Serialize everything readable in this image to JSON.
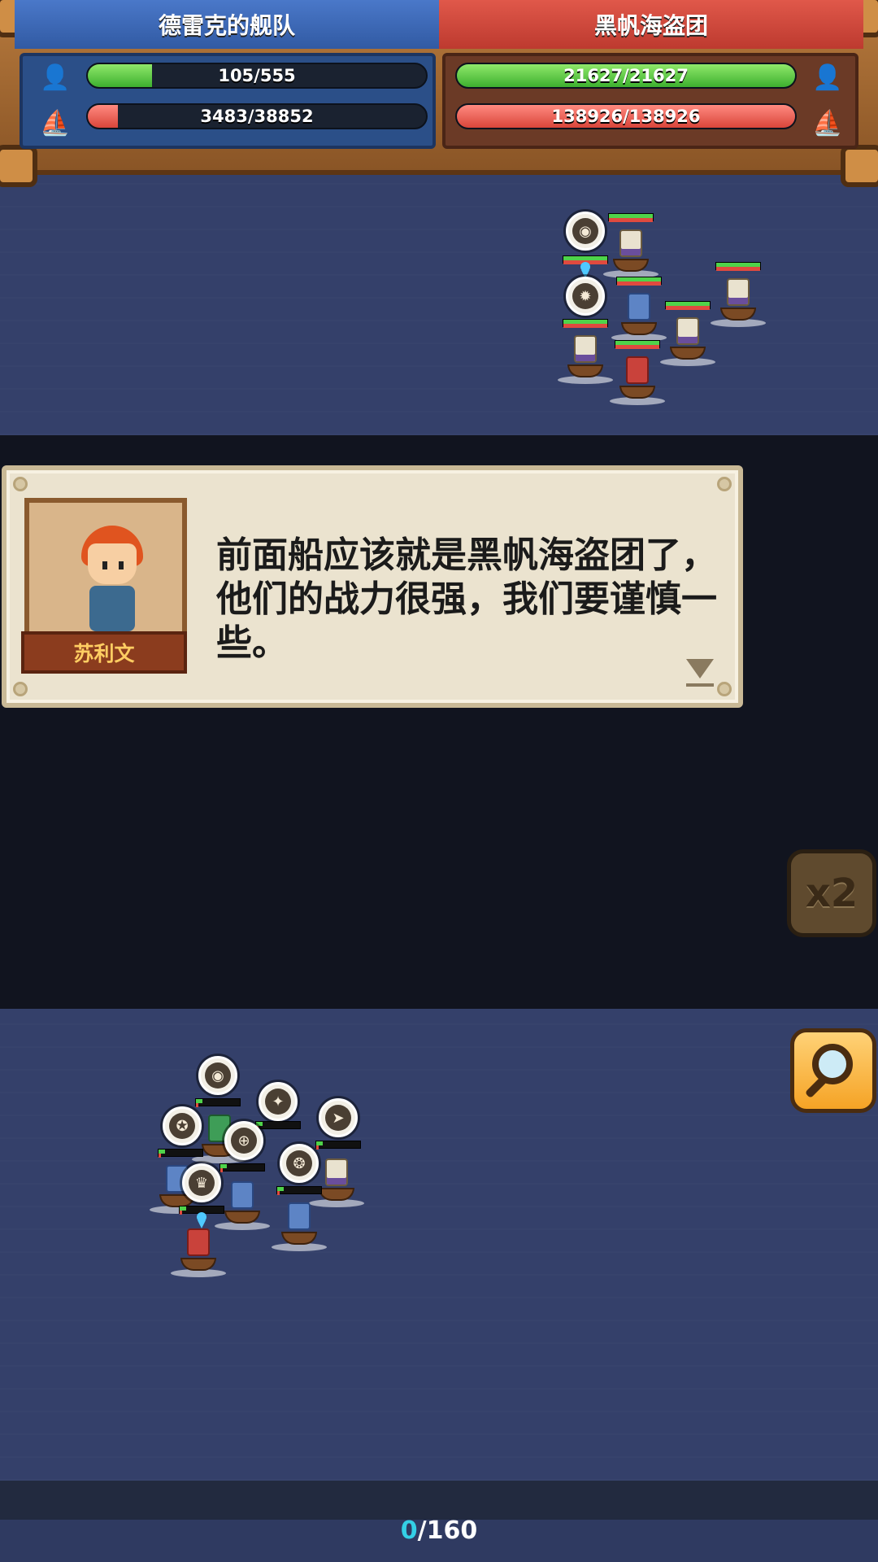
{
  "header": {
    "left_team": {
      "name": "德雷克的舰队",
      "crew_text": "105/555",
      "crew_fill": 0.19,
      "ship_text": "3483/38852",
      "ship_fill": 0.09
    },
    "right_team": {
      "name": "黑帆海盗团",
      "crew_text": "21627/21627",
      "crew_fill": 1.0,
      "ship_text": "138926/138926",
      "ship_fill": 1.0
    }
  },
  "dialog": {
    "speaker": "苏利文",
    "text": "前面船应该就是黑帆海盗团了，他们的战力很强，我们要谨慎一些。"
  },
  "buttons": {
    "speed_label": "x2"
  },
  "footer": {
    "current": "0",
    "total": "/160"
  },
  "colors": {
    "ally_blue": "#315aa3",
    "enemy_red": "#bd3a2f",
    "counter_cyan": "#34d0e6"
  }
}
